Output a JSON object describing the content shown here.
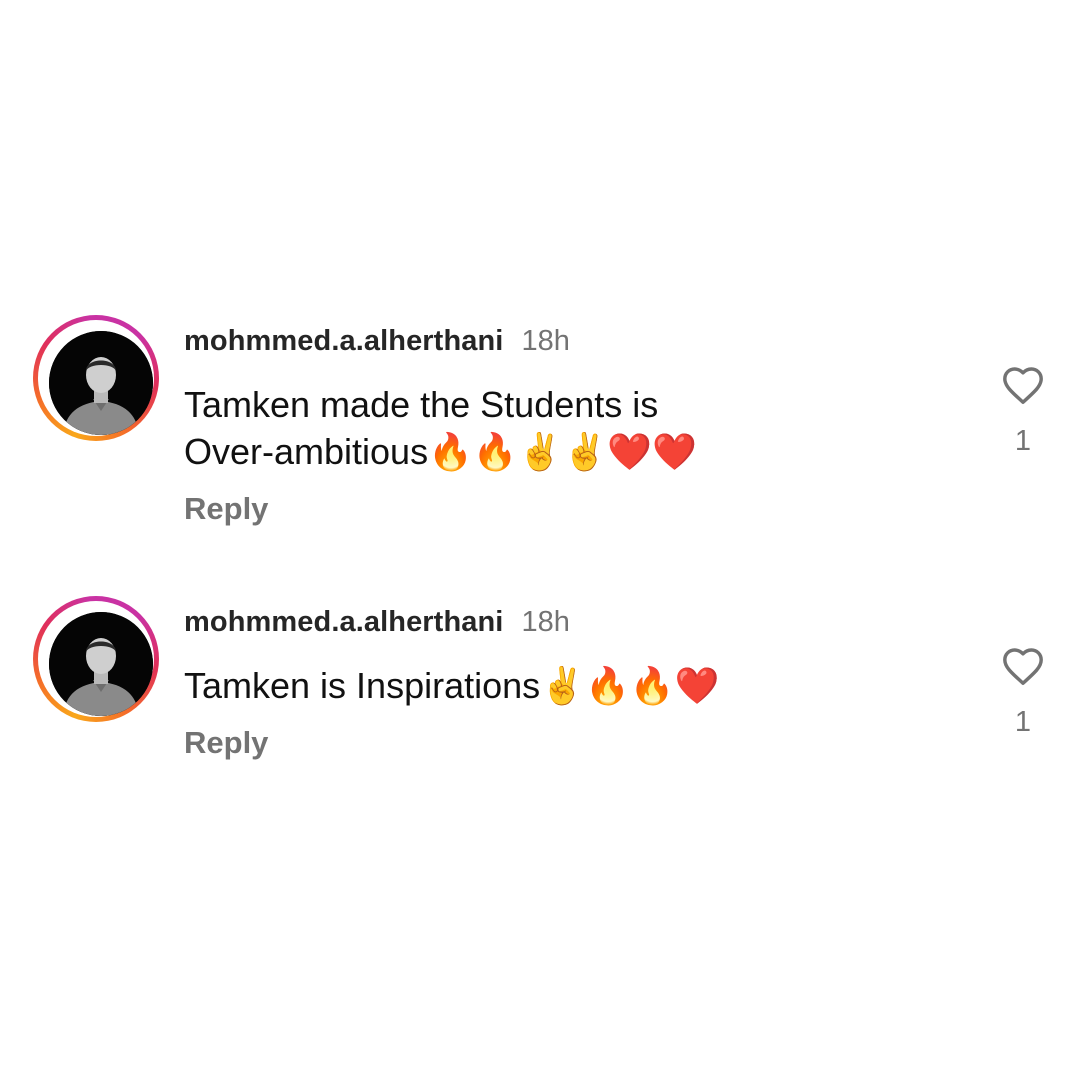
{
  "comments": [
    {
      "username": "mohmmed.a.alherthani",
      "time": "18h",
      "text": "Tamken made the Students is\nOver-ambitious🔥🔥✌️✌️❤️❤️",
      "reply_label": "Reply",
      "like_icon": "heart-outline-icon",
      "like_count": "1"
    },
    {
      "username": "mohmmed.a.alherthani",
      "time": "18h",
      "text": "Tamken is Inspirations✌️🔥🔥❤️",
      "reply_label": "Reply",
      "like_icon": "heart-outline-icon",
      "like_count": "1"
    }
  ],
  "colors": {
    "username": "#262626",
    "secondary_text": "#737373",
    "story_ring_start": "#f9a71a",
    "story_ring_end": "#c932a3"
  }
}
